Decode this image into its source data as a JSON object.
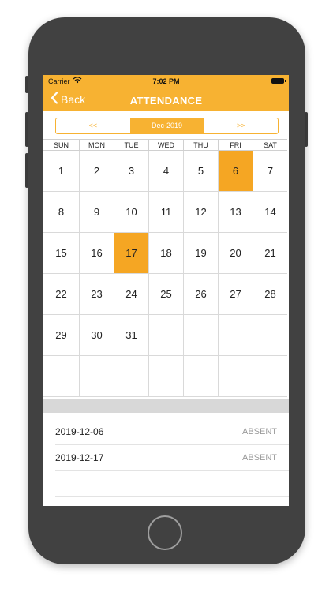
{
  "status_bar": {
    "carrier": "Carrier",
    "time": "7:02 PM"
  },
  "nav": {
    "back_label": "Back",
    "title": "ATTENDANCE"
  },
  "month_switch": {
    "prev": "<<",
    "current": "Dec-2019",
    "next": ">>"
  },
  "calendar": {
    "weekdays": [
      "SUN",
      "MON",
      "TUE",
      "WED",
      "THU",
      "FRI",
      "SAT"
    ],
    "days": [
      "1",
      "2",
      "3",
      "4",
      "5",
      "6",
      "7",
      "8",
      "9",
      "10",
      "11",
      "12",
      "13",
      "14",
      "15",
      "16",
      "17",
      "18",
      "19",
      "20",
      "21",
      "22",
      "23",
      "24",
      "25",
      "26",
      "27",
      "28",
      "29",
      "30",
      "31",
      "",
      "",
      "",
      "",
      "",
      "",
      "",
      "",
      "",
      "",
      ""
    ],
    "marked_days": [
      "6",
      "17"
    ],
    "marked_color": "#F5A623"
  },
  "records": [
    {
      "date": "2019-12-06",
      "status": "ABSENT"
    },
    {
      "date": "2019-12-17",
      "status": "ABSENT"
    }
  ],
  "theme": {
    "accent": "#F7B232"
  }
}
